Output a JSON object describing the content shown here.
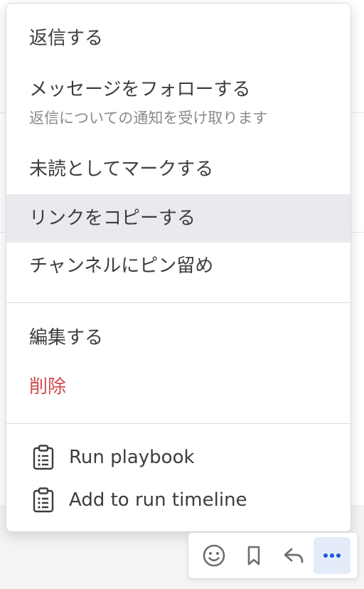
{
  "menu": {
    "items": [
      {
        "label": "返信する"
      },
      {
        "label": "メッセージをフォローする",
        "sublabel": "返信についての通知を受け取ります"
      },
      {
        "label": "未読としてマークする"
      },
      {
        "label": "リンクをコピーする",
        "highlighted": true
      },
      {
        "label": "チャンネルにピン留め"
      },
      {
        "label": "編集する"
      },
      {
        "label": "削除",
        "color": "#d24b4e"
      }
    ],
    "plugin_items": [
      {
        "label": "Run playbook",
        "icon": "clipboard-checklist-icon"
      },
      {
        "label": "Add to run timeline",
        "icon": "clipboard-checklist-icon"
      }
    ]
  },
  "toolbar": {
    "buttons": [
      {
        "icon": "emoji-icon"
      },
      {
        "icon": "bookmark-icon"
      },
      {
        "icon": "reply-icon"
      },
      {
        "icon": "more-dots-icon",
        "active": true
      }
    ],
    "accent": "#1c58d9"
  }
}
